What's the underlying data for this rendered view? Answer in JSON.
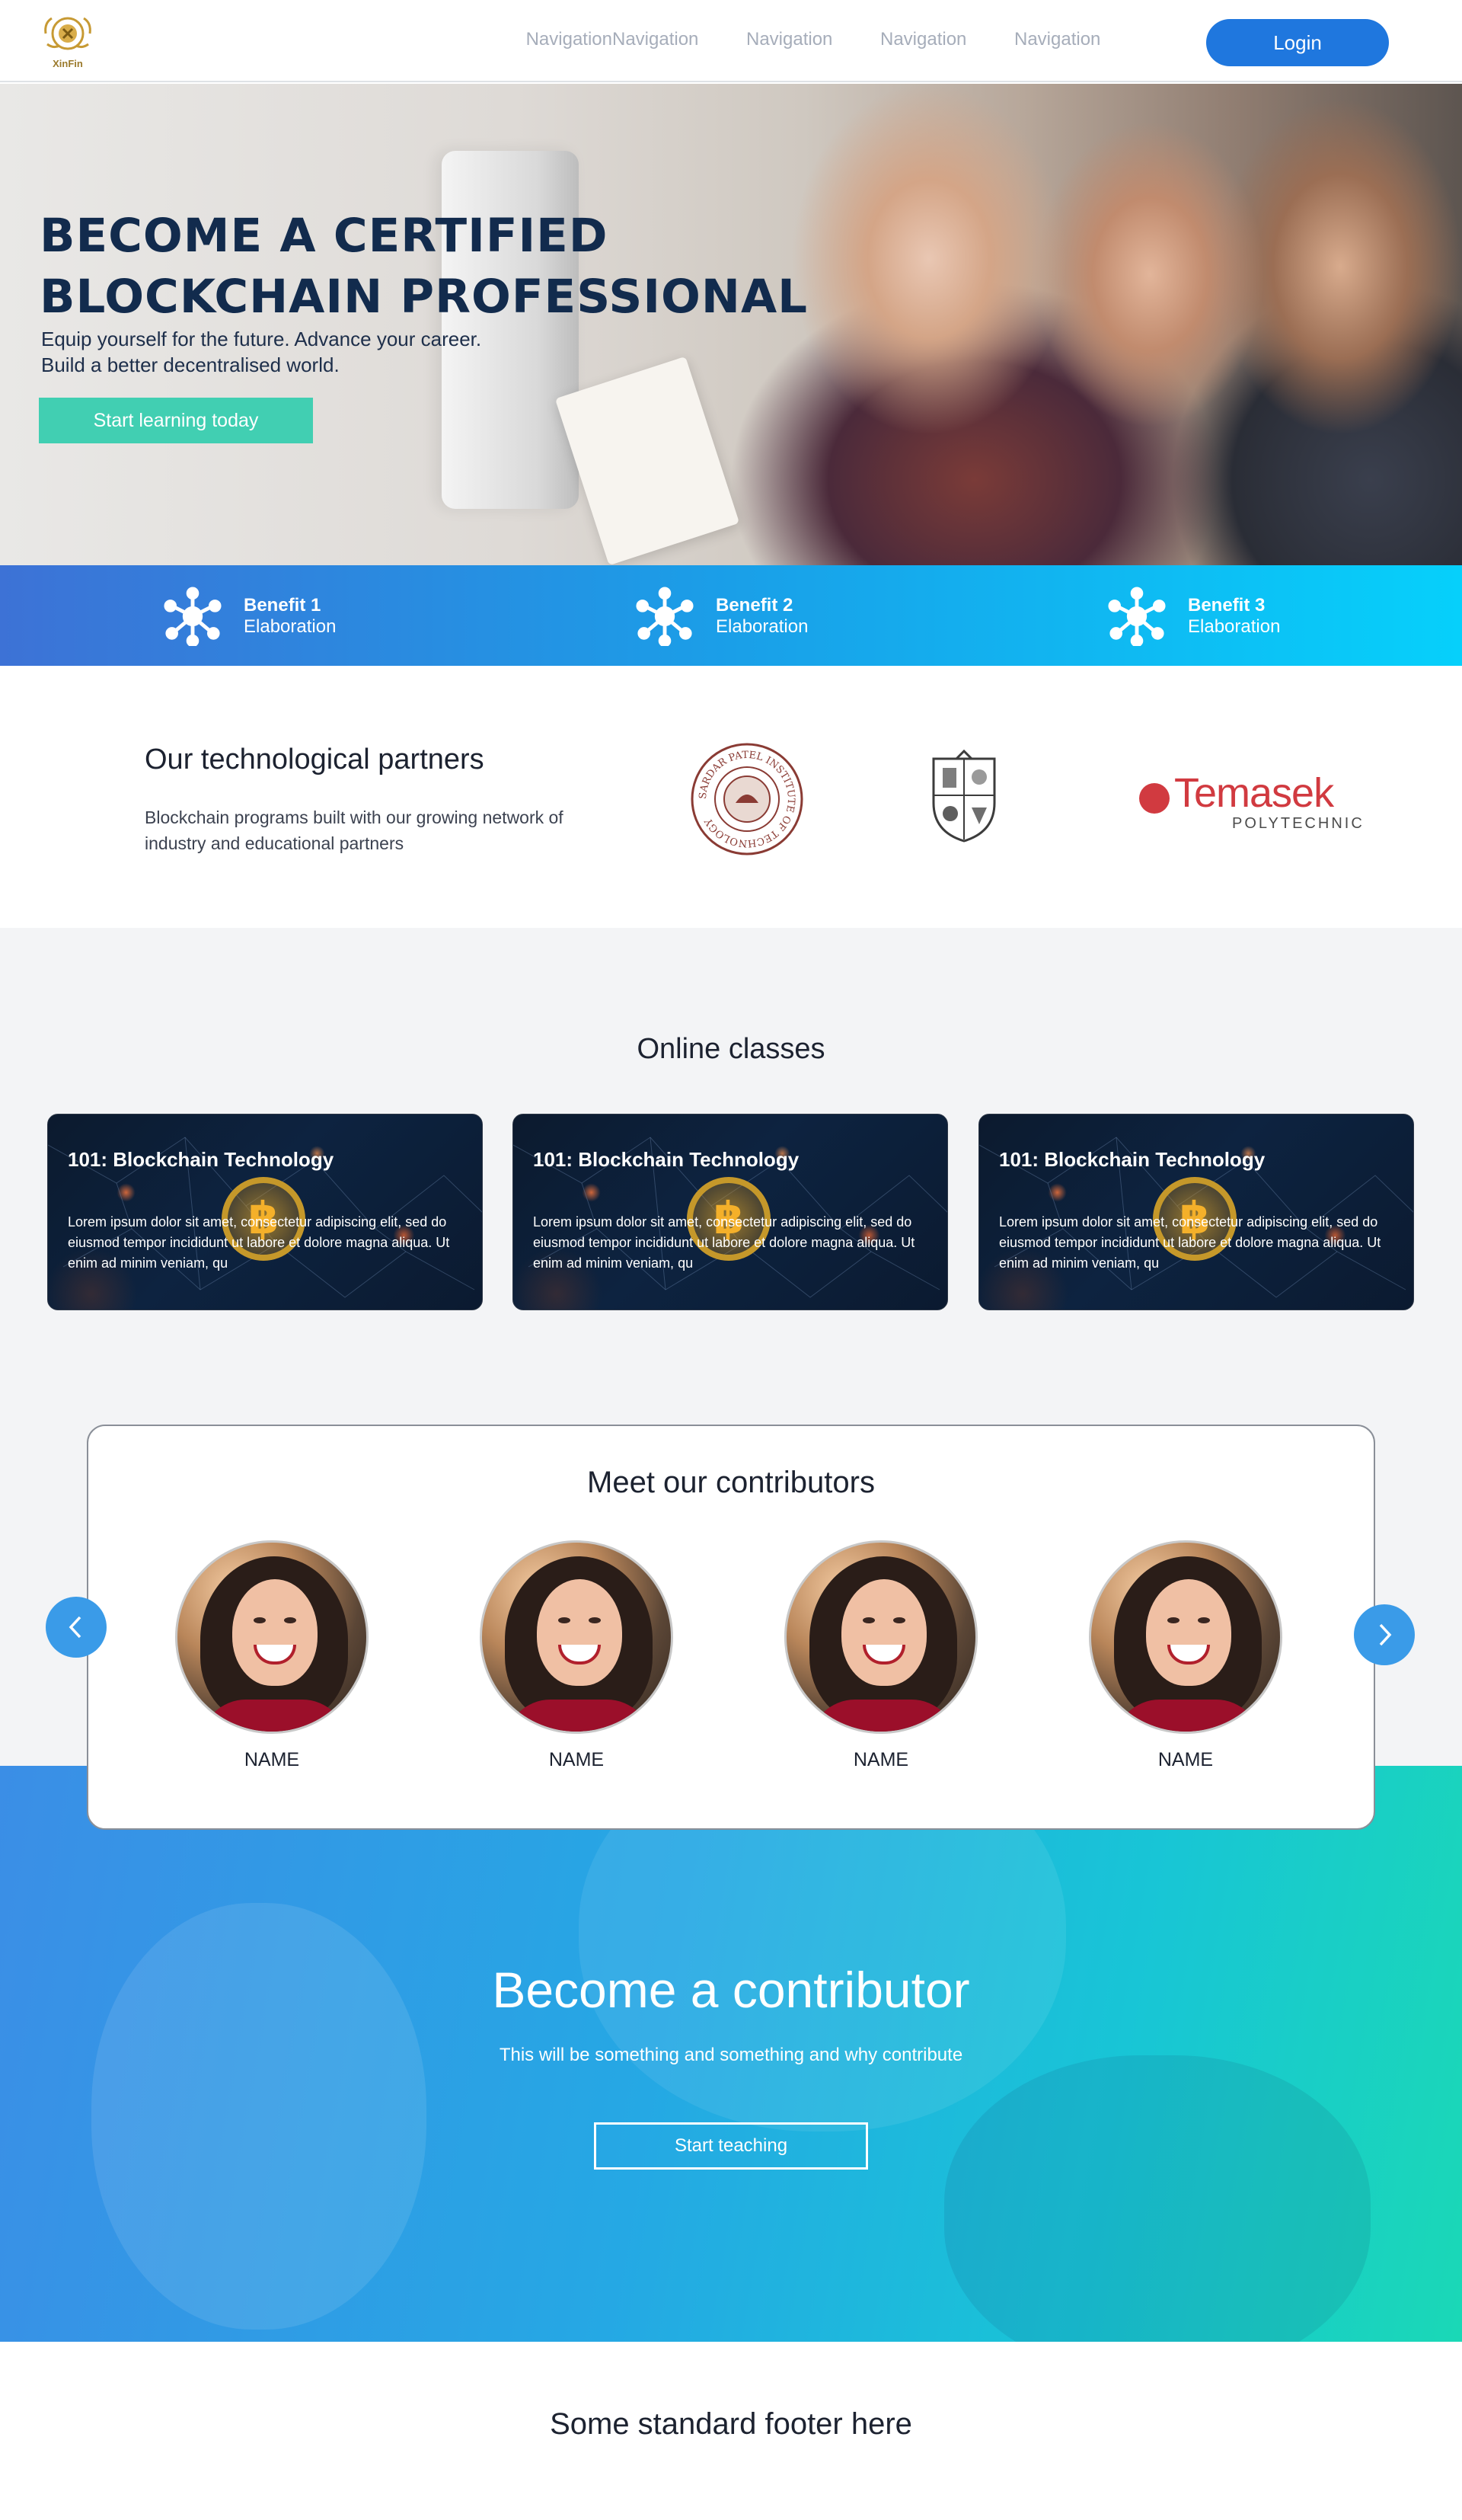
{
  "header": {
    "logo_text": "XinFin",
    "nav": [
      "Navigation",
      "Navigation",
      "Navigation",
      "Navigation",
      "Navigation"
    ],
    "login_label": "Login"
  },
  "hero": {
    "title_line1": "BECOME A CERTIFIED",
    "title_line2": "BLOCKCHAIN PROFESSIONAL",
    "subtitle_line1": "Equip yourself for the future. Advance your career.",
    "subtitle_line2": "Build a better decentralised world.",
    "cta_label": "Start learning today"
  },
  "benefits": [
    {
      "title": "Benefit 1",
      "text": "Elaboration",
      "icon": "network-icon"
    },
    {
      "title": "Benefit 2",
      "text": "Elaboration",
      "icon": "network-icon"
    },
    {
      "title": "Benefit 3",
      "text": "Elaboration",
      "icon": "network-icon"
    }
  ],
  "partners": {
    "title": "Our technological partners",
    "text": "Blockchain programs built with our growing network of industry and educational partners",
    "logos": [
      {
        "name": "sardar-patel-institute-seal",
        "ring_text": "SARDAR PATEL INSTITUTE OF TECHNOLOGY"
      },
      {
        "name": "crest-logo"
      },
      {
        "name": "temasek-polytechnic",
        "word": "Temasek",
        "sub": "POLYTECHNIC"
      }
    ]
  },
  "classes": {
    "title": "Online classes",
    "cards": [
      {
        "title": "101: Blockchain Technology",
        "text": "Lorem ipsum dolor sit amet, consectetur adipiscing elit, sed do eiusmod tempor incididunt ut labore et dolore magna aliqua. Ut enim ad minim veniam, qu"
      },
      {
        "title": "101: Blockchain Technology",
        "text": "Lorem ipsum dolor sit amet, consectetur adipiscing elit, sed do eiusmod tempor incididunt ut labore et dolore magna aliqua. Ut enim ad minim veniam, qu"
      },
      {
        "title": "101: Blockchain Technology",
        "text": "Lorem ipsum dolor sit amet, consectetur adipiscing elit, sed do eiusmod tempor incididunt ut labore et dolore magna aliqua. Ut enim ad minim veniam, qu"
      }
    ]
  },
  "contributors": {
    "title": "Meet our contributors",
    "people": [
      {
        "name": "NAME"
      },
      {
        "name": "NAME"
      },
      {
        "name": "NAME"
      },
      {
        "name": "NAME"
      }
    ],
    "prev_icon": "chevron-left-icon",
    "next_icon": "chevron-right-icon"
  },
  "become": {
    "title": "Become a contributor",
    "text": "This will be something and something and why contribute",
    "button_label": "Start teaching"
  },
  "footer": {
    "text": "Some standard footer here"
  },
  "colors": {
    "primary": "#1f77de",
    "cta": "#41cfb2",
    "benefit_start": "#3d72d6",
    "benefit_end": "#06d0fb",
    "hero_title": "#122b4d",
    "arrow": "#3a9be8",
    "temasek_red": "#d13a40"
  }
}
